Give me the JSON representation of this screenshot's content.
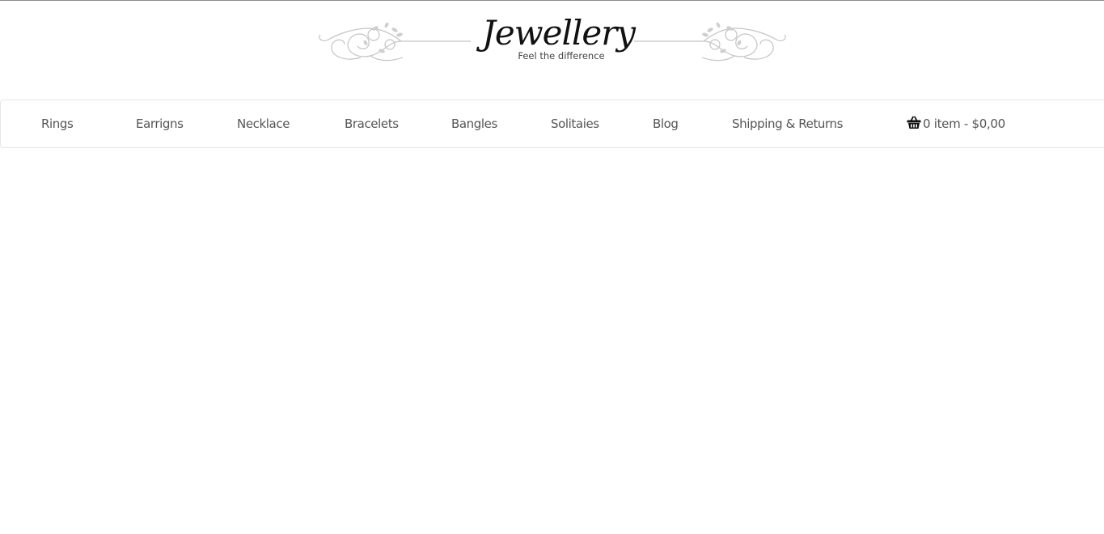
{
  "logo": {
    "title": "Jewellery",
    "tagline": "Feel the difference"
  },
  "nav": {
    "items": [
      {
        "label": "Rings"
      },
      {
        "label": "Earrigns"
      },
      {
        "label": "Necklace"
      },
      {
        "label": "Bracelets"
      },
      {
        "label": "Bangles"
      },
      {
        "label": "Solitaies"
      },
      {
        "label": "Blog"
      },
      {
        "label": "Shipping & Returns"
      }
    ]
  },
  "cart": {
    "icon": "basket-icon",
    "summary": "0 item - $0,00"
  },
  "colors": {
    "nav_text": "#555555",
    "logo_text": "#111111",
    "ornament": "#c8c8c8"
  }
}
